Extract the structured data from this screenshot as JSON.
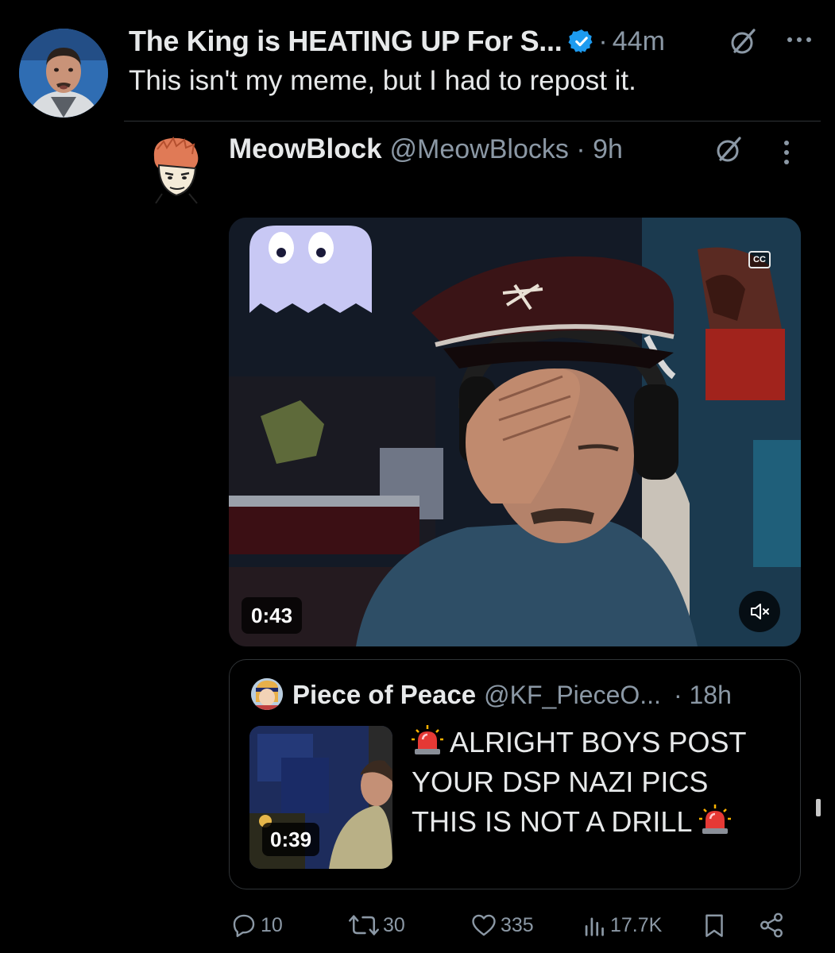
{
  "tweet": {
    "display_name": "The King is HEATING UP For S...",
    "separator": "·",
    "time": "44m",
    "text": "This isn't my meme, but I had to repost it."
  },
  "reply": {
    "display_name": "MeowBlock",
    "handle_time": "@MeowBlocks · 9h"
  },
  "video": {
    "cc_label": "CC",
    "duration": "0:43"
  },
  "quote": {
    "display_name": "Piece of Peace",
    "handle": "@KF_PieceO...",
    "time": "· 18h",
    "thumb_duration": "0:39",
    "text_line1": "ALRIGHT BOYS POST",
    "text_line2": "YOUR DSP NAZI PICS",
    "text_line3": "THIS IS NOT A DRILL"
  },
  "actions": {
    "replies": "10",
    "reposts": "30",
    "likes": "335",
    "views": "17.7K"
  },
  "icons": {
    "verified": "verified-badge-icon",
    "grok": "grok-icon",
    "more": "more-icon",
    "mute": "speaker-muted-icon",
    "siren": "police-siren-emoji",
    "reply": "reply-icon",
    "repost": "repost-icon",
    "like": "heart-icon",
    "views": "views-icon",
    "bookmark": "bookmark-icon",
    "share": "share-icon"
  },
  "colors": {
    "background": "#000000",
    "text": "#e7e9ea",
    "muted": "#8b98a5",
    "verified": "#1d9bf0",
    "border": "#2f3336"
  }
}
